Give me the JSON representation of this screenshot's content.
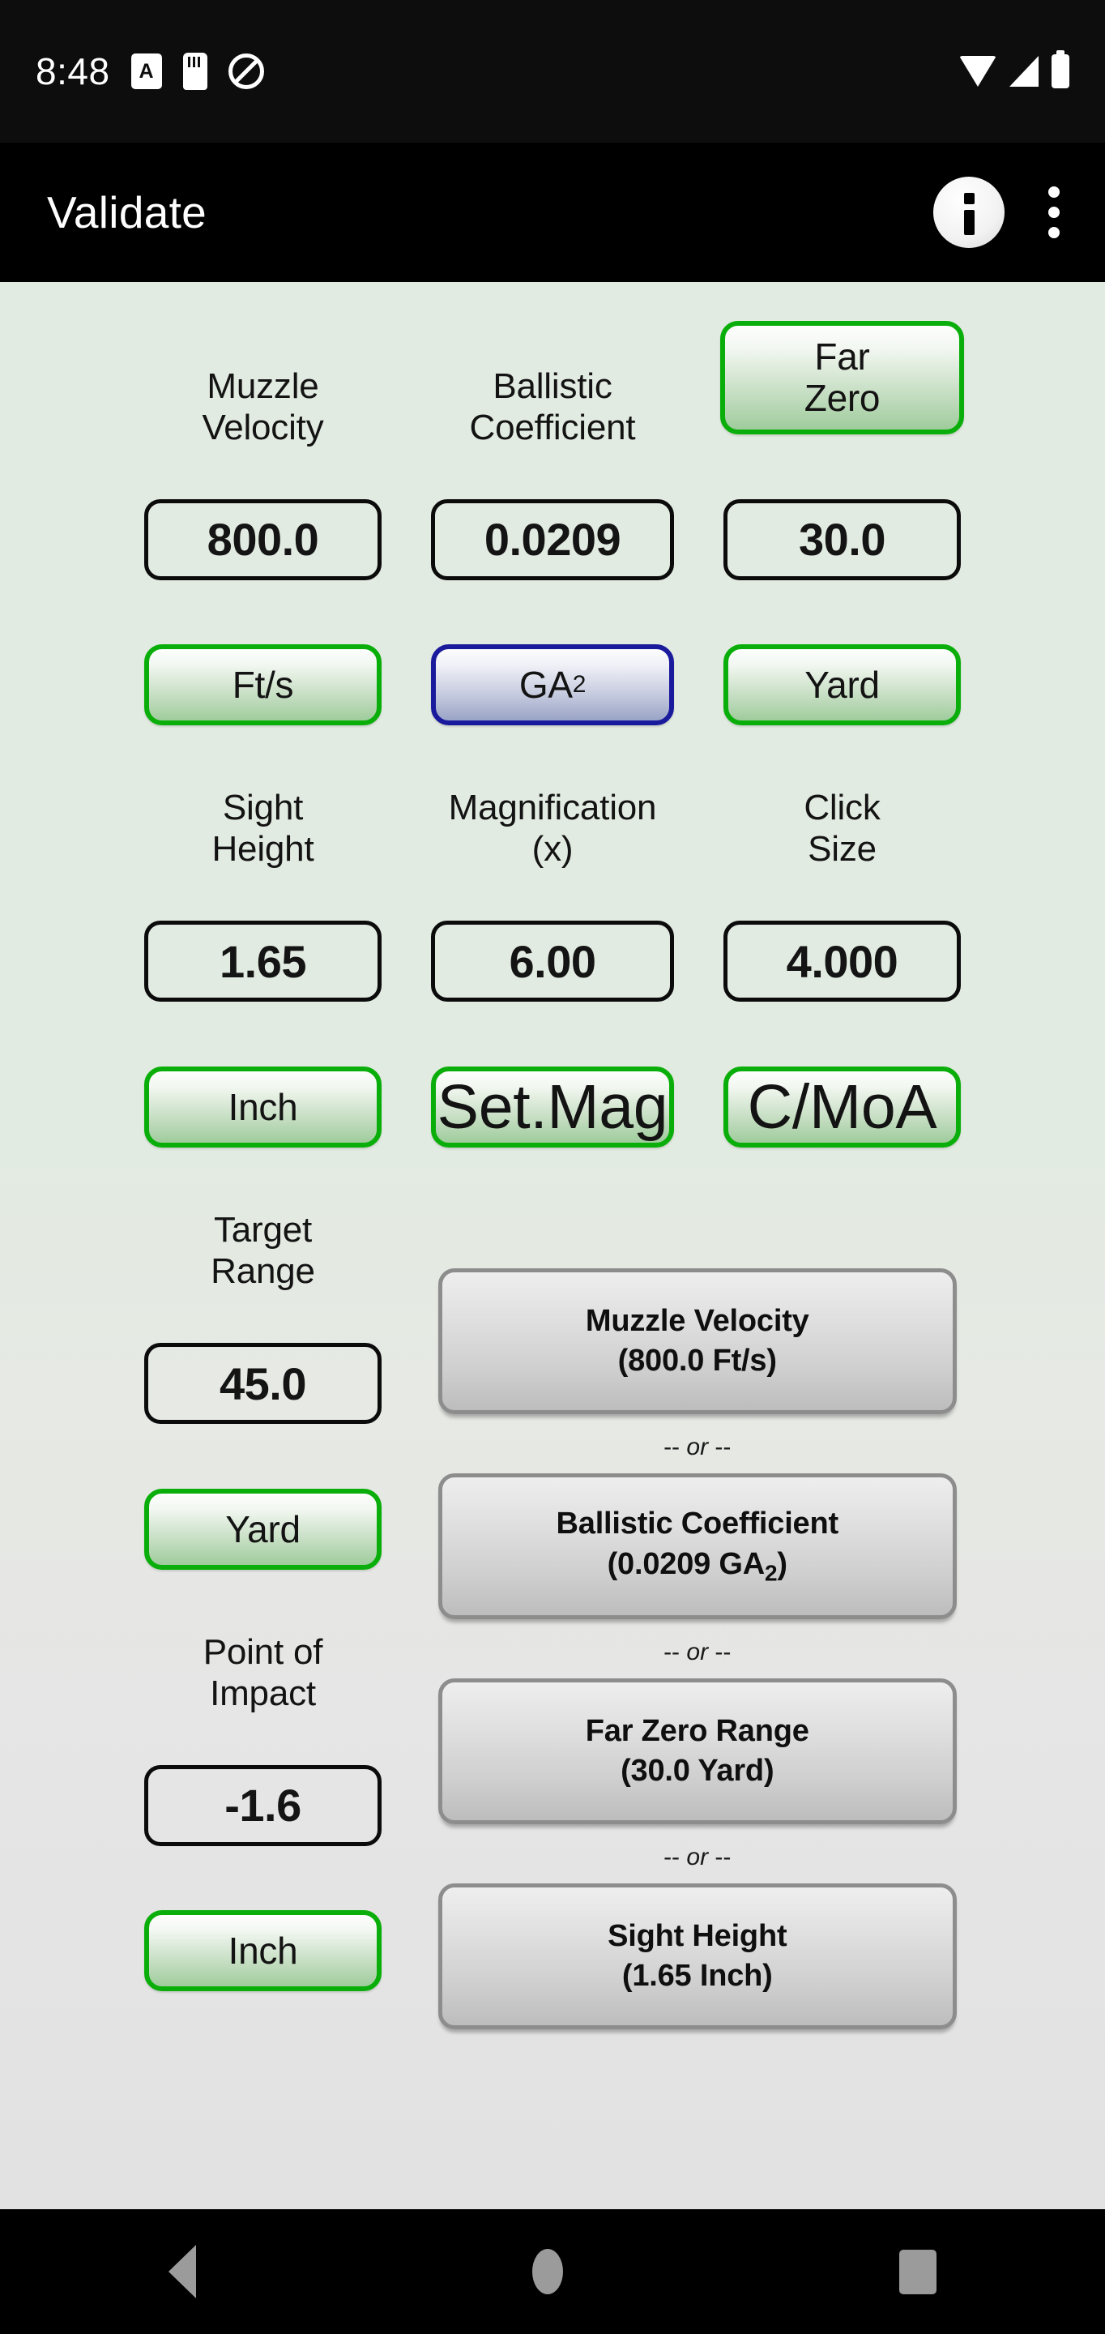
{
  "status_bar": {
    "time": "8:48",
    "icons": [
      "letter-a-icon",
      "sd-card-icon",
      "do-not-disturb-icon"
    ],
    "right_icons": [
      "wifi-icon",
      "cell-signal-icon",
      "battery-icon"
    ]
  },
  "app_bar": {
    "title": "Validate",
    "info_label": "i",
    "info_icon": "info-circle-icon",
    "overflow_icon": "overflow-menu-icon"
  },
  "fields": {
    "muzzle_velocity": {
      "label": "Muzzle\nVelocity",
      "label_l1": "Muzzle",
      "label_l2": "Velocity",
      "value": "800.0",
      "unit": "Ft/s"
    },
    "ballistic_coefficient": {
      "label": "Ballistic\nCoefficient",
      "label_l1": "Ballistic",
      "label_l2": "Coefficient",
      "value": "0.0209",
      "unit": "GA",
      "unit_sub": "2"
    },
    "far_zero": {
      "label_l1": "Far",
      "label_l2": "Zero",
      "value": "30.0",
      "unit": "Yard"
    },
    "sight_height": {
      "label_l1": "Sight",
      "label_l2": "Height",
      "value": "1.65",
      "unit": "Inch"
    },
    "magnification": {
      "label_l1": "Magnification",
      "label_l2": "(x)",
      "value": "6.00",
      "unit": "Set.Mag"
    },
    "click_size": {
      "label_l1": "Click",
      "label_l2": "Size",
      "value": "4.000",
      "unit": "C/MoA"
    },
    "target_range": {
      "label_l1": "Target",
      "label_l2": "Range",
      "value": "45.0",
      "unit": "Yard"
    },
    "point_of_impact": {
      "label_l1": "Point of",
      "label_l2": "Impact",
      "value": "-1.6",
      "unit": "Inch"
    }
  },
  "solve_for": {
    "separator": "-- or --",
    "separator_prefix": "--",
    "separator_word": "or",
    "separator_suffix": "--",
    "buttons": [
      {
        "title": "Muzzle Velocity",
        "detail": "(800.0 Ft/s)"
      },
      {
        "title": "Ballistic Coefficient",
        "detail_pre": "(0.0209 GA",
        "detail_sub": "2",
        "detail_post": ")"
      },
      {
        "title": "Far Zero Range",
        "detail": "(30.0 Yard)"
      },
      {
        "title": "Sight Height",
        "detail": "(1.65 Inch)"
      }
    ]
  },
  "nav_bar": {
    "back": "back-icon",
    "home": "home-icon",
    "recents": "recents-icon"
  },
  "colors": {
    "accent_green": "#0aae0a",
    "accent_blue": "#1a1a9c",
    "background_top": "#e2ebe1",
    "background_bottom": "#e2e2e2",
    "app_bar": "#000000"
  }
}
